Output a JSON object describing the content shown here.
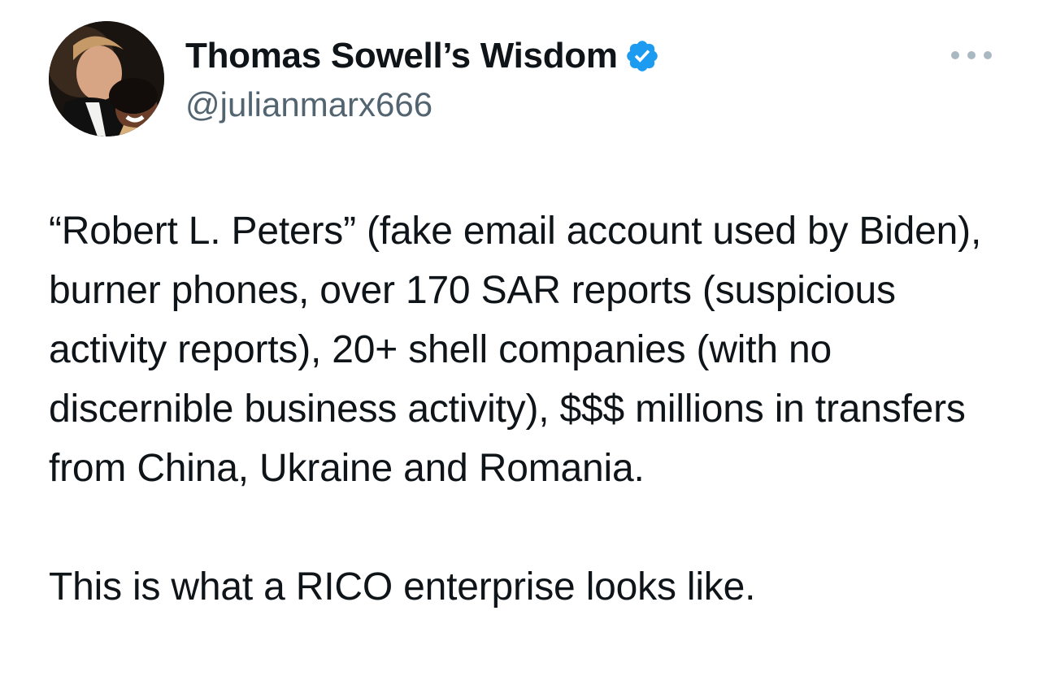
{
  "author": {
    "display_name": "Thomas Sowell’s Wisdom",
    "handle": "@julianmarx666",
    "verified": true,
    "verified_icon": "verified-badge-icon",
    "verified_color": "#1d9bf0",
    "avatar_icon": "profile-photo"
  },
  "menu": {
    "icon": "more-options-icon"
  },
  "tweet": {
    "paragraphs": [
      "“Robert L. Peters” (fake email account used by Biden), burner phones, over 170 SAR reports (suspicious activity reports), 20+ shell companies (with no discernible business activity), $$$ millions in transfers from China, Ukraine and Romania.",
      "This is what a RICO enterprise looks like."
    ]
  },
  "colors": {
    "text": "#0f1419",
    "secondary_text": "#536471",
    "background": "#ffffff"
  }
}
